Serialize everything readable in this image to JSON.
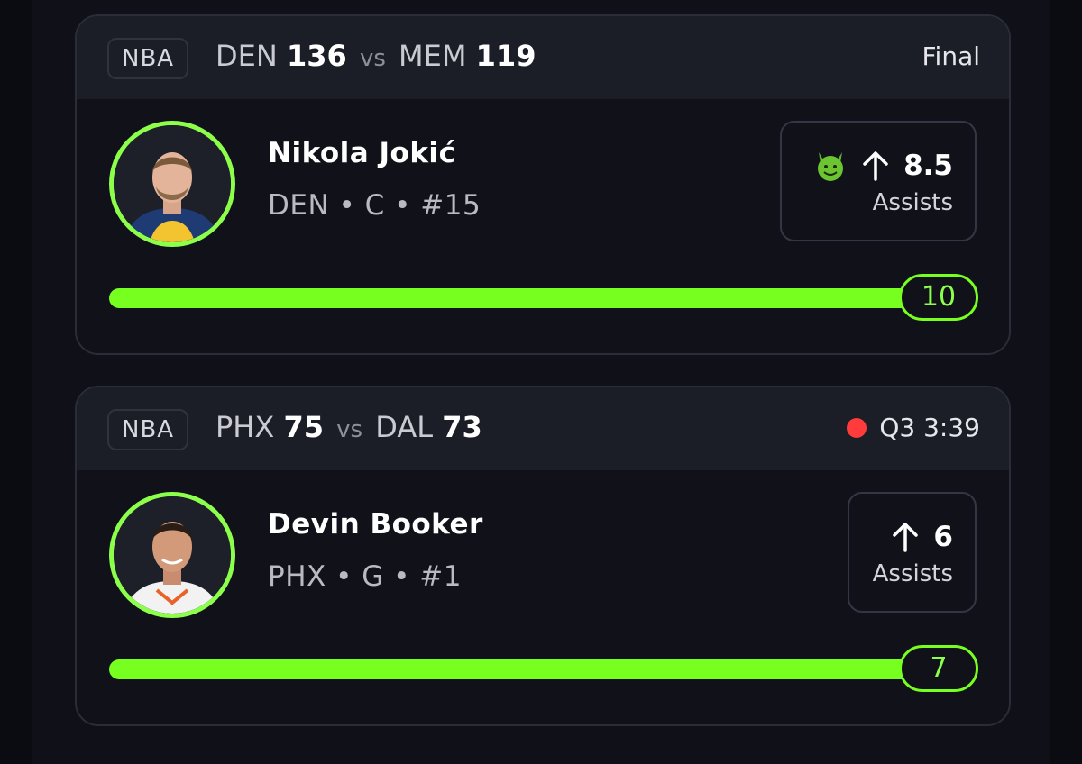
{
  "cards": [
    {
      "league": "NBA",
      "home_team": "DEN",
      "home_score": "136",
      "vs": "vs",
      "away_team": "MEM",
      "away_score": "119",
      "status": "Final",
      "live": false,
      "player": {
        "name": "Nikola Jokić",
        "meta": "DEN • C • #15",
        "avatar_icon": "player-headshot"
      },
      "line": {
        "badge_icon": "green-devil-emoji-icon",
        "direction_icon": "arrow-up-icon",
        "value": "8.5",
        "stat": "Assists"
      },
      "progress": {
        "current": "10",
        "fraction": 1.0
      }
    },
    {
      "league": "NBA",
      "home_team": "PHX",
      "home_score": "75",
      "vs": "vs",
      "away_team": "DAL",
      "away_score": "73",
      "status": "Q3 3:39",
      "live": true,
      "player": {
        "name": "Devin Booker",
        "meta": "PHX • G • #1",
        "avatar_icon": "player-headshot"
      },
      "line": {
        "direction_icon": "arrow-up-icon",
        "value": "6",
        "stat": "Assists"
      },
      "progress": {
        "current": "7",
        "fraction": 1.0
      }
    }
  ],
  "colors": {
    "accent": "#77ff1f",
    "live": "#ff3b3b",
    "background": "#0b0c12",
    "card": "#101119",
    "card_header": "#1b1d27"
  }
}
